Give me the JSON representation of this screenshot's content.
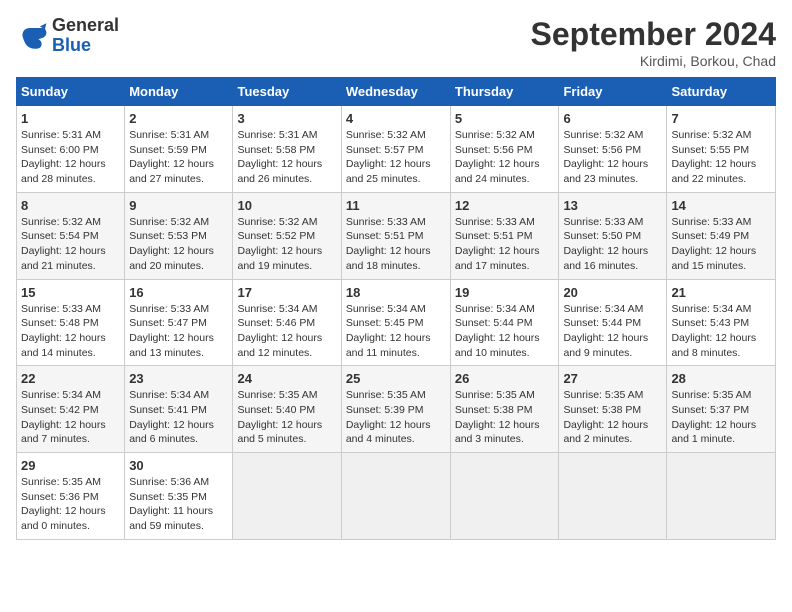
{
  "header": {
    "logo_general": "General",
    "logo_blue": "Blue",
    "month_title": "September 2024",
    "location": "Kirdimi, Borkou, Chad"
  },
  "days_of_week": [
    "Sunday",
    "Monday",
    "Tuesday",
    "Wednesday",
    "Thursday",
    "Friday",
    "Saturday"
  ],
  "weeks": [
    [
      {
        "day": "1",
        "sunrise": "5:31 AM",
        "sunset": "6:00 PM",
        "daylight": "12 hours and 28 minutes."
      },
      {
        "day": "2",
        "sunrise": "5:31 AM",
        "sunset": "5:59 PM",
        "daylight": "12 hours and 27 minutes."
      },
      {
        "day": "3",
        "sunrise": "5:31 AM",
        "sunset": "5:58 PM",
        "daylight": "12 hours and 26 minutes."
      },
      {
        "day": "4",
        "sunrise": "5:32 AM",
        "sunset": "5:57 PM",
        "daylight": "12 hours and 25 minutes."
      },
      {
        "day": "5",
        "sunrise": "5:32 AM",
        "sunset": "5:56 PM",
        "daylight": "12 hours and 24 minutes."
      },
      {
        "day": "6",
        "sunrise": "5:32 AM",
        "sunset": "5:56 PM",
        "daylight": "12 hours and 23 minutes."
      },
      {
        "day": "7",
        "sunrise": "5:32 AM",
        "sunset": "5:55 PM",
        "daylight": "12 hours and 22 minutes."
      }
    ],
    [
      {
        "day": "8",
        "sunrise": "5:32 AM",
        "sunset": "5:54 PM",
        "daylight": "12 hours and 21 minutes."
      },
      {
        "day": "9",
        "sunrise": "5:32 AM",
        "sunset": "5:53 PM",
        "daylight": "12 hours and 20 minutes."
      },
      {
        "day": "10",
        "sunrise": "5:32 AM",
        "sunset": "5:52 PM",
        "daylight": "12 hours and 19 minutes."
      },
      {
        "day": "11",
        "sunrise": "5:33 AM",
        "sunset": "5:51 PM",
        "daylight": "12 hours and 18 minutes."
      },
      {
        "day": "12",
        "sunrise": "5:33 AM",
        "sunset": "5:51 PM",
        "daylight": "12 hours and 17 minutes."
      },
      {
        "day": "13",
        "sunrise": "5:33 AM",
        "sunset": "5:50 PM",
        "daylight": "12 hours and 16 minutes."
      },
      {
        "day": "14",
        "sunrise": "5:33 AM",
        "sunset": "5:49 PM",
        "daylight": "12 hours and 15 minutes."
      }
    ],
    [
      {
        "day": "15",
        "sunrise": "5:33 AM",
        "sunset": "5:48 PM",
        "daylight": "12 hours and 14 minutes."
      },
      {
        "day": "16",
        "sunrise": "5:33 AM",
        "sunset": "5:47 PM",
        "daylight": "12 hours and 13 minutes."
      },
      {
        "day": "17",
        "sunrise": "5:34 AM",
        "sunset": "5:46 PM",
        "daylight": "12 hours and 12 minutes."
      },
      {
        "day": "18",
        "sunrise": "5:34 AM",
        "sunset": "5:45 PM",
        "daylight": "12 hours and 11 minutes."
      },
      {
        "day": "19",
        "sunrise": "5:34 AM",
        "sunset": "5:44 PM",
        "daylight": "12 hours and 10 minutes."
      },
      {
        "day": "20",
        "sunrise": "5:34 AM",
        "sunset": "5:44 PM",
        "daylight": "12 hours and 9 minutes."
      },
      {
        "day": "21",
        "sunrise": "5:34 AM",
        "sunset": "5:43 PM",
        "daylight": "12 hours and 8 minutes."
      }
    ],
    [
      {
        "day": "22",
        "sunrise": "5:34 AM",
        "sunset": "5:42 PM",
        "daylight": "12 hours and 7 minutes."
      },
      {
        "day": "23",
        "sunrise": "5:34 AM",
        "sunset": "5:41 PM",
        "daylight": "12 hours and 6 minutes."
      },
      {
        "day": "24",
        "sunrise": "5:35 AM",
        "sunset": "5:40 PM",
        "daylight": "12 hours and 5 minutes."
      },
      {
        "day": "25",
        "sunrise": "5:35 AM",
        "sunset": "5:39 PM",
        "daylight": "12 hours and 4 minutes."
      },
      {
        "day": "26",
        "sunrise": "5:35 AM",
        "sunset": "5:38 PM",
        "daylight": "12 hours and 3 minutes."
      },
      {
        "day": "27",
        "sunrise": "5:35 AM",
        "sunset": "5:38 PM",
        "daylight": "12 hours and 2 minutes."
      },
      {
        "day": "28",
        "sunrise": "5:35 AM",
        "sunset": "5:37 PM",
        "daylight": "12 hours and 1 minute."
      }
    ],
    [
      {
        "day": "29",
        "sunrise": "5:35 AM",
        "sunset": "5:36 PM",
        "daylight": "12 hours and 0 minutes."
      },
      {
        "day": "30",
        "sunrise": "5:36 AM",
        "sunset": "5:35 PM",
        "daylight": "11 hours and 59 minutes."
      },
      null,
      null,
      null,
      null,
      null
    ]
  ],
  "labels": {
    "sunrise": "Sunrise:",
    "sunset": "Sunset:",
    "daylight": "Daylight:"
  }
}
